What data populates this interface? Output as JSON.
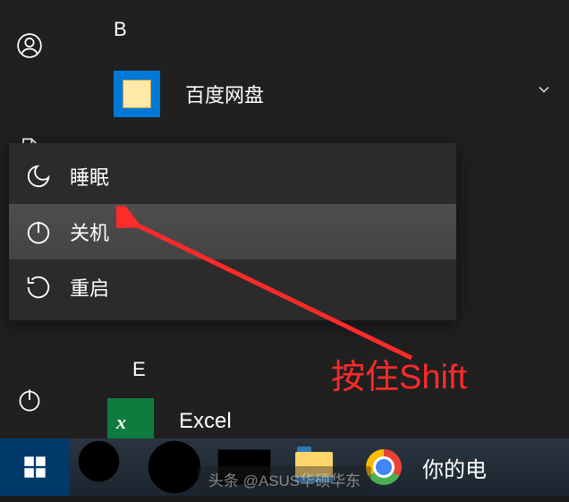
{
  "sections": {
    "b_header": "B",
    "e_header": "E"
  },
  "apps": {
    "baidu": {
      "label": "百度网盘"
    },
    "excel": {
      "label": "Excel"
    }
  },
  "power_menu": {
    "sleep": "睡眠",
    "shutdown": "关机",
    "restart": "重启"
  },
  "annotation": {
    "text": "按住Shift"
  },
  "taskbar": {
    "text": "你的电"
  },
  "watermark": "头条 @ASUS华硕华东"
}
